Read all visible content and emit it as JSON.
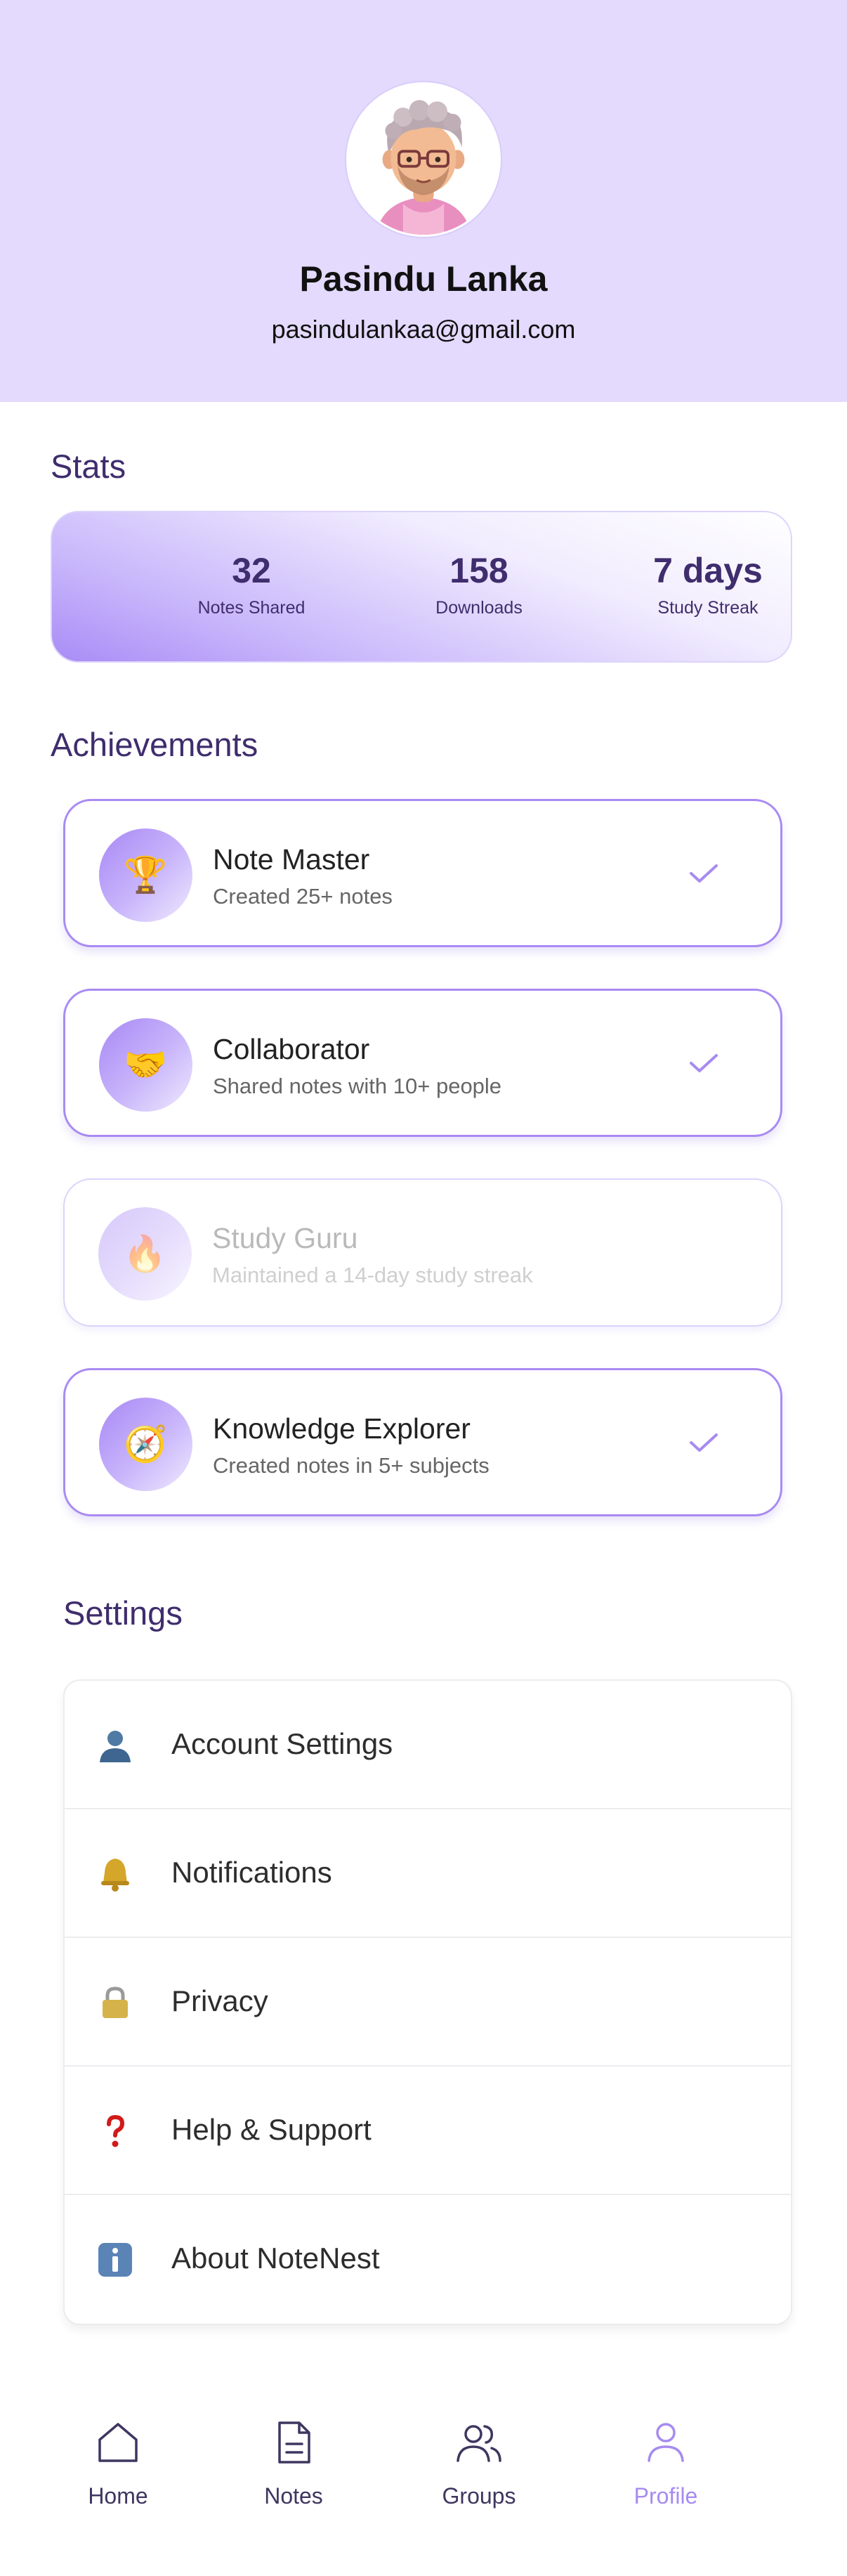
{
  "profile": {
    "name": "Pasindu Lanka",
    "email": "pasindulankaa@gmail.com"
  },
  "stats": {
    "title": "Stats",
    "items": [
      {
        "value": "32",
        "label": "Notes Shared"
      },
      {
        "value": "158",
        "label": "Downloads"
      },
      {
        "value": "7 days",
        "label": "Study Streak"
      }
    ]
  },
  "achievements": {
    "title": "Achievements",
    "items": [
      {
        "icon": "trophy-icon",
        "glyph": "🏆",
        "title": "Note Master",
        "description": "Created 25+ notes",
        "unlocked": true
      },
      {
        "icon": "handshake-icon",
        "glyph": "🤝",
        "title": "Collaborator",
        "description": "Shared notes with 10+ people",
        "unlocked": true
      },
      {
        "icon": "fire-icon",
        "glyph": "🔥",
        "title": "Study Guru",
        "description": "Maintained a 14-day study streak",
        "unlocked": false
      },
      {
        "icon": "compass-icon",
        "glyph": "🧭",
        "title": "Knowledge Explorer",
        "description": "Created notes in 5+ subjects",
        "unlocked": true
      }
    ]
  },
  "settings": {
    "title": "Settings",
    "items": [
      {
        "icon": "user-icon",
        "label": "Account Settings"
      },
      {
        "icon": "bell-icon",
        "label": "Notifications"
      },
      {
        "icon": "lock-icon",
        "label": "Privacy"
      },
      {
        "icon": "question-icon",
        "label": "Help & Support"
      },
      {
        "icon": "info-icon",
        "label": "About NoteNest"
      }
    ]
  },
  "tabbar": {
    "items": [
      {
        "icon": "home-icon",
        "label": "Home",
        "active": false
      },
      {
        "icon": "notes-icon",
        "label": "Notes",
        "active": false
      },
      {
        "icon": "groups-icon",
        "label": "Groups",
        "active": false
      },
      {
        "icon": "profile-icon",
        "label": "Profile",
        "active": true
      }
    ]
  },
  "colors": {
    "header_bg": "#e3dafd",
    "accent": "#a78bf0",
    "title_text": "#3f2d6d"
  }
}
